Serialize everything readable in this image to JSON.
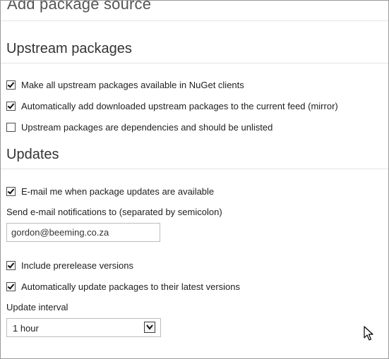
{
  "header": {
    "title": "Add package source"
  },
  "upstream": {
    "heading": "Upstream packages",
    "options": [
      {
        "label": "Make all upstream packages available in NuGet clients",
        "checked": true
      },
      {
        "label": "Automatically add downloaded upstream packages to the current feed (mirror)",
        "checked": true
      },
      {
        "label": "Upstream packages are dependencies and should be unlisted",
        "checked": false
      }
    ]
  },
  "updates": {
    "heading": "Updates",
    "email_option": {
      "label": "E-mail me when package updates are available",
      "checked": true
    },
    "email_field": {
      "label": "Send e-mail notifications to (separated by semicolon)",
      "value": "gordon@beeming.co.za"
    },
    "prerelease_option": {
      "label": "Include prerelease versions",
      "checked": true
    },
    "auto_update_option": {
      "label": "Automatically update packages to their latest versions",
      "checked": true
    },
    "interval": {
      "label": "Update interval",
      "selected": "1 hour"
    }
  },
  "icons": {
    "checkbox": "checkbox-icon",
    "dropdown": "chevron-down-icon",
    "cursor": "mouse-pointer-icon"
  }
}
